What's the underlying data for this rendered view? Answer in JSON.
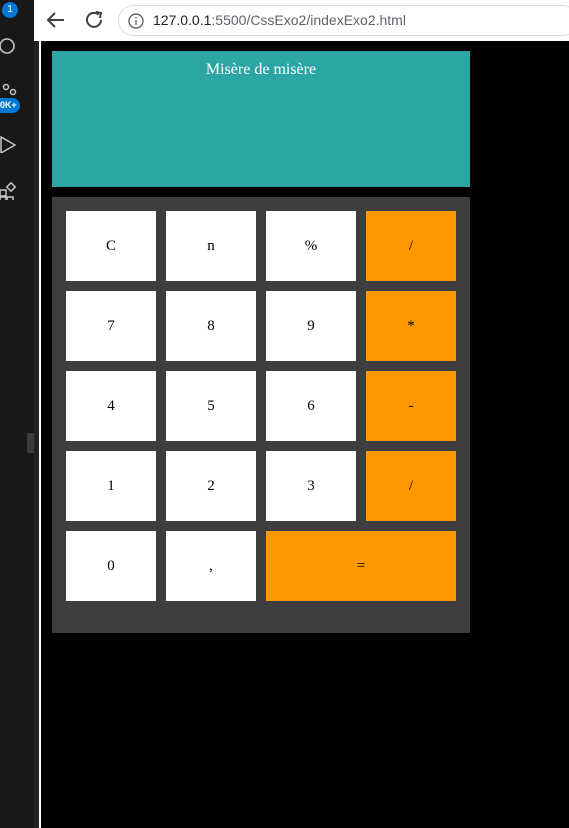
{
  "activity_bar": {
    "notification_count": "1",
    "ok_badge": "0K+"
  },
  "browser": {
    "url_host": "127.0.0.1",
    "url_rest": ":5500/CssExo2/indexExo2.html"
  },
  "calculator": {
    "display_text": "Misère de misère",
    "keys": [
      {
        "label": "C",
        "type": "num"
      },
      {
        "label": "n",
        "type": "num"
      },
      {
        "label": "%",
        "type": "num"
      },
      {
        "label": "/",
        "type": "op"
      },
      {
        "label": "7",
        "type": "num"
      },
      {
        "label": "8",
        "type": "num"
      },
      {
        "label": "9",
        "type": "num"
      },
      {
        "label": "*",
        "type": "op"
      },
      {
        "label": "4",
        "type": "num"
      },
      {
        "label": "5",
        "type": "num"
      },
      {
        "label": "6",
        "type": "num"
      },
      {
        "label": "-",
        "type": "op"
      },
      {
        "label": "1",
        "type": "num"
      },
      {
        "label": "2",
        "type": "num"
      },
      {
        "label": "3",
        "type": "num"
      },
      {
        "label": "/",
        "type": "op"
      },
      {
        "label": "0",
        "type": "num"
      },
      {
        "label": ",",
        "type": "num"
      },
      {
        "label": "=",
        "type": "op"
      }
    ],
    "colors": {
      "display_bg": "#2ca5a5",
      "pad_bg": "#3e3e3e",
      "key_bg": "#ffffff",
      "operator_bg": "#ff9800"
    }
  }
}
